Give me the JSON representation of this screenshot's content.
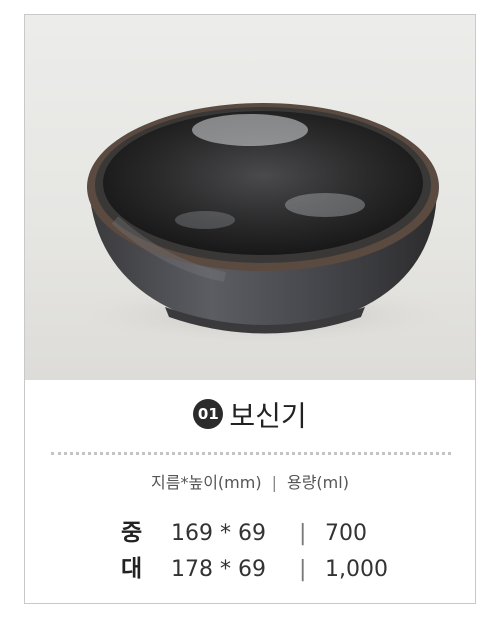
{
  "product": {
    "number": "01",
    "name": "보신기"
  },
  "spec_header": {
    "dimension_label": "지름*높이(mm)",
    "separator": "|",
    "volume_label": "용량(ml)"
  },
  "specs": [
    {
      "size": "중",
      "dimensions": "169 * 69",
      "separator": "|",
      "volume": "700"
    },
    {
      "size": "대",
      "dimensions": "178 * 69",
      "separator": "|",
      "volume": "1,000"
    }
  ],
  "colors": {
    "badge": "#2b2b2b",
    "border": "#c9c9c9",
    "dots": "#c4c4c4",
    "bowl": "#2e2d2d"
  }
}
